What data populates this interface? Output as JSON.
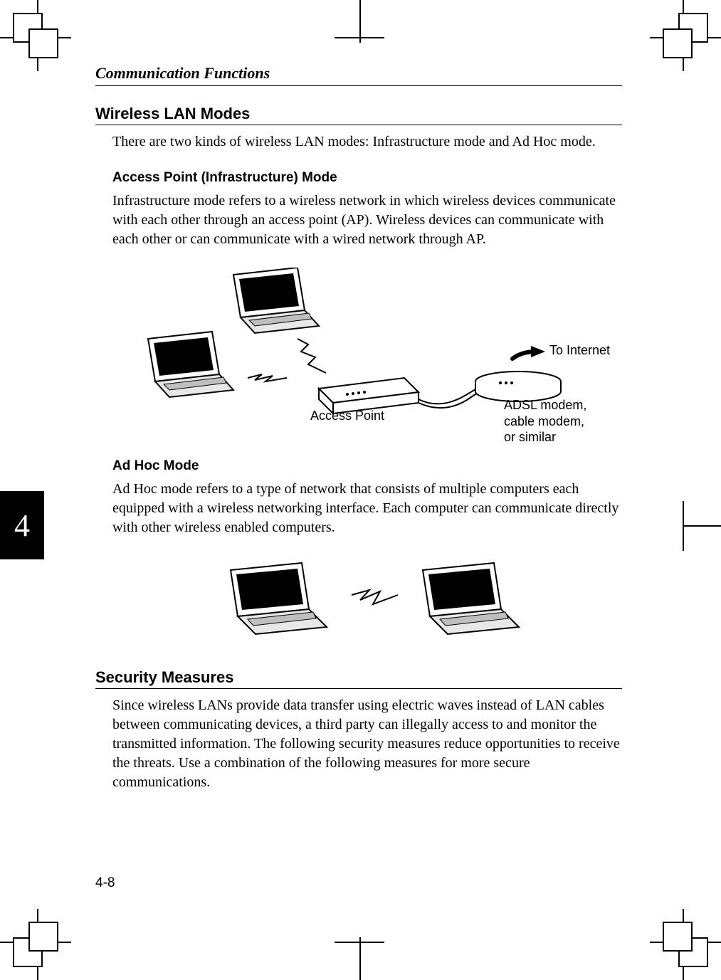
{
  "chapter_title": "Communication Functions",
  "page_tab": "4",
  "page_number": "4-8",
  "sections": {
    "wlan": {
      "heading": "Wireless LAN Modes",
      "intro": "There are two kinds of wireless LAN modes: Infrastructure mode and Ad Hoc mode.",
      "ap": {
        "heading": "Access Point (Infrastructure) Mode",
        "body": "Infrastructure mode refers to a wireless network in which wireless devices communicate with each other through an access point (AP). Wireless devices can communicate with each other or can communicate with a wired network through AP.",
        "labels": {
          "access_point": "Access Point",
          "to_internet": "To Internet",
          "modem_l1": "ADSL modem,",
          "modem_l2": "cable modem,",
          "modem_l3": "or similar"
        }
      },
      "adhoc": {
        "heading": "Ad Hoc Mode",
        "body": "Ad Hoc mode refers to a type of network that consists of multiple computers each equipped with a wireless networking interface. Each computer can communicate directly with other wireless enabled computers."
      }
    },
    "security": {
      "heading": "Security Measures",
      "body": "Since wireless LANs provide data transfer using electric waves instead of LAN cables between communicating devices, a third party can illegally access to and monitor the transmitted information. The following security measures reduce opportunities to receive the threats. Use a combination of the following measures for more secure communications."
    }
  }
}
